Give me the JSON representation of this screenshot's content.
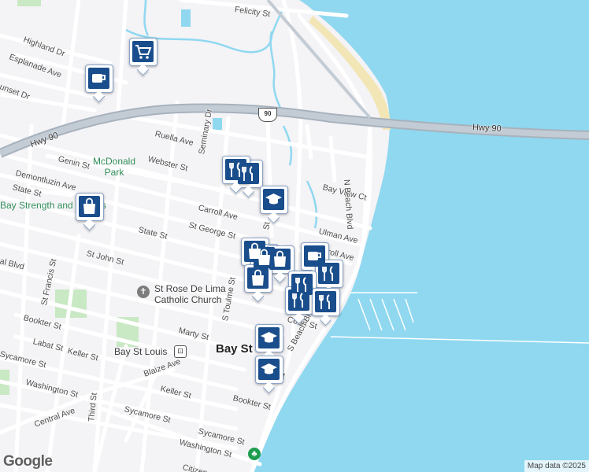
{
  "map": {
    "water_color": "#8fd8f0",
    "land_color": "#f4f3f6",
    "park_color": "#c9e8c4",
    "road_color": "#ffffff",
    "highway_color": "#a7b2bd",
    "marker_fill": "#1a4d8c"
  },
  "labels": {
    "felicity_st": "Felicity St",
    "highland_dr": "Highland Dr",
    "esplanade_ave": "Esplanade Ave",
    "sunset_dr": "unset Dr",
    "hwy90_left": "Hwy 90",
    "hwy90_right": "Hwy 90",
    "hwy90_shield": "90",
    "ruella_ave": "Ruella Ave",
    "seminary_dr": "Seminary Dr",
    "webster_st": "Webster St",
    "genin_st": "Genin St",
    "demontluzin_ave": "Demontluzin Ave",
    "state_st_left": "State St",
    "carroll_ave": "Carroll Ave",
    "bay_view_ct": "Bay View Ct",
    "n_beach_blvd": "N Beach Blvd",
    "state_st": "State St",
    "st_george_st": "St George St",
    "ulman_ave": "Ulman Ave",
    "carroll_ave_2": "roll Ave",
    "st_john_st": "St John St",
    "central_blvd": "al Blvd",
    "st_francis_st": "St Francis St",
    "s_toulme_st": "S Toulme St",
    "bookter_st": "Bookter St",
    "marty_st": "Marty St",
    "court_st": "Court St",
    "labat_st": "Labat St",
    "keller_st": "Keller St",
    "sycamore_st_left": "Sycamore St",
    "s_beach_blvd": "S Beach Blvd",
    "blaize_ave": "Blaize Ave",
    "washington_st_left": "Washington St",
    "keller_st_2": "Keller St",
    "bookter_st_2": "Bookter St",
    "sycamore_st": "Sycamore St",
    "washington_st": "Washington St",
    "central_ave": "Central Ave",
    "third_st": "Third St",
    "citizen_st": "Citizen",
    "st_label": "St",
    "st_label_2": "St"
  },
  "places": {
    "mcdonald_park_line1": "McDonald",
    "mcdonald_park_line2": "Park",
    "bay_strength": "Bay Strength and Fitness",
    "st_rose_line1": "St Rose De Lima",
    "st_rose_line2": "Catholic Church",
    "bay_st_louis_station": "Bay St Louis",
    "city_name": "Bay St"
  },
  "markers": [
    {
      "icon": "cart-icon",
      "kind": "shopping"
    },
    {
      "icon": "coffee-icon",
      "kind": "cafe"
    },
    {
      "icon": "fork-knife-icon",
      "kind": "restaurant"
    },
    {
      "icon": "shopping-bag-icon",
      "kind": "store"
    },
    {
      "icon": "fork-knife-icon",
      "kind": "restaurant"
    },
    {
      "icon": "shopping-bag-icon",
      "kind": "store"
    },
    {
      "icon": "graduation-cap-icon",
      "kind": "school"
    },
    {
      "icon": "shopping-bag-icon",
      "kind": "store"
    },
    {
      "icon": "shopping-bag-icon",
      "kind": "store"
    },
    {
      "icon": "shopping-bag-icon",
      "kind": "store"
    },
    {
      "icon": "coffee-icon",
      "kind": "cafe"
    },
    {
      "icon": "fork-knife-icon",
      "kind": "restaurant"
    },
    {
      "icon": "fork-knife-icon",
      "kind": "restaurant"
    },
    {
      "icon": "fork-knife-icon",
      "kind": "restaurant"
    },
    {
      "icon": "fork-knife-icon",
      "kind": "restaurant"
    },
    {
      "icon": "graduation-cap-icon",
      "kind": "school"
    },
    {
      "icon": "graduation-cap-icon",
      "kind": "school"
    }
  ],
  "footer": {
    "logo": "Google",
    "attribution": "Map data ©2025"
  }
}
